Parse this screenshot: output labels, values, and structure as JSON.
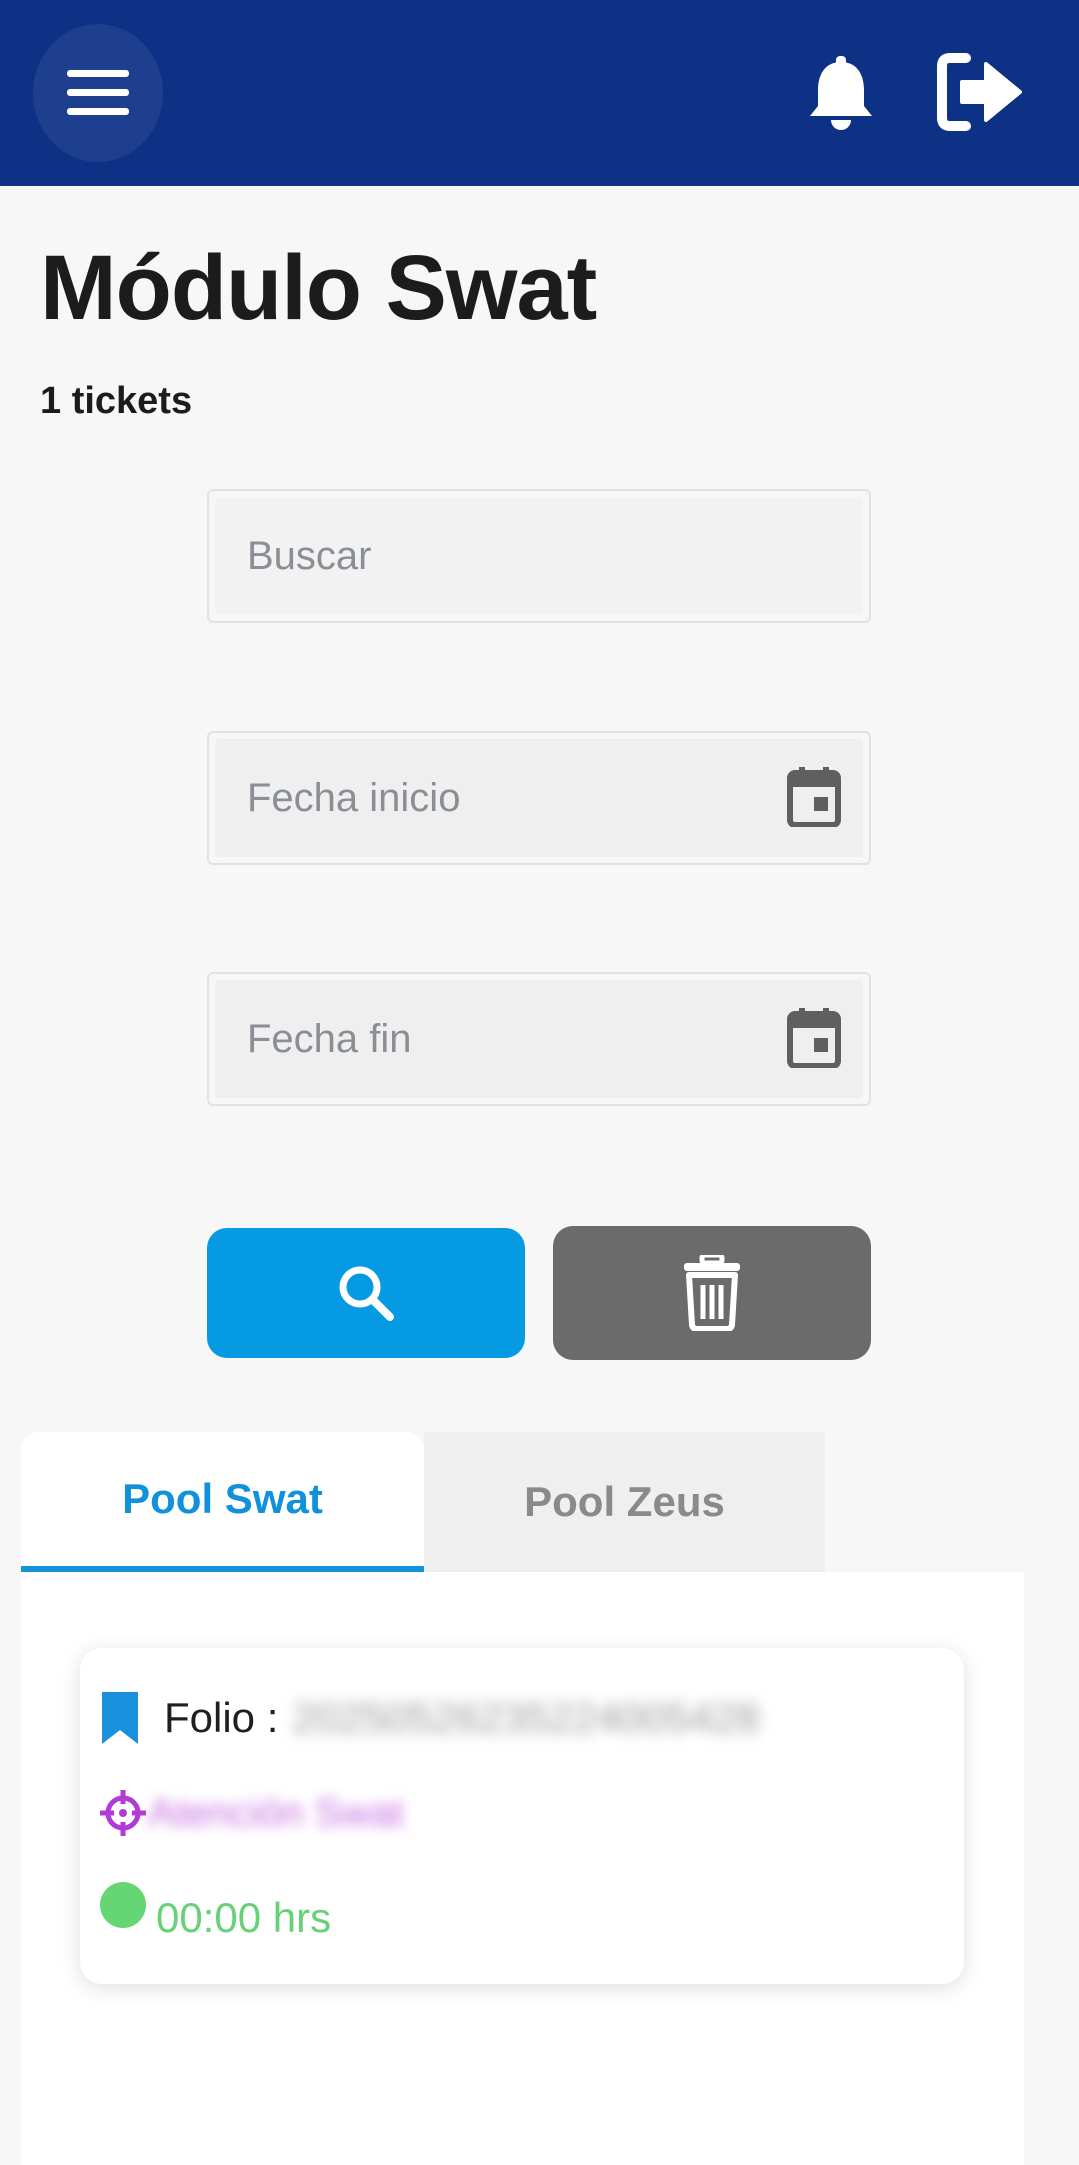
{
  "header": {
    "menu_icon": "hamburger-menu-icon",
    "notifications_icon": "bell-icon",
    "logout_icon": "sign-out-icon",
    "background_color": "#0d3185"
  },
  "page": {
    "title": "Módulo Swat",
    "ticket_count": "1 tickets"
  },
  "filters": {
    "search_placeholder": "Buscar",
    "search_value": "",
    "start_date_placeholder": "Fecha inicio",
    "start_date_value": "",
    "end_date_placeholder": "Fecha fin",
    "end_date_value": "",
    "calendar_icon": "calendar-icon"
  },
  "actions": {
    "search_icon": "magnifier-icon",
    "search_color": "#069ae3",
    "clear_icon": "trash-icon",
    "clear_color": "#6b6b6b"
  },
  "tabs": [
    {
      "label": "Pool Swat",
      "active": true
    },
    {
      "label": "Pool Zeus",
      "active": false
    }
  ],
  "tickets": [
    {
      "folio_label": "Folio :",
      "folio_value": "20250526235224005428",
      "category": "Atención Swat",
      "elapsed": "00:00 hrs",
      "bookmark_icon": "bookmark-icon",
      "category_icon": "crosshair-icon",
      "status_icon": "green-status-dot",
      "status_color": "#65d673"
    }
  ]
}
